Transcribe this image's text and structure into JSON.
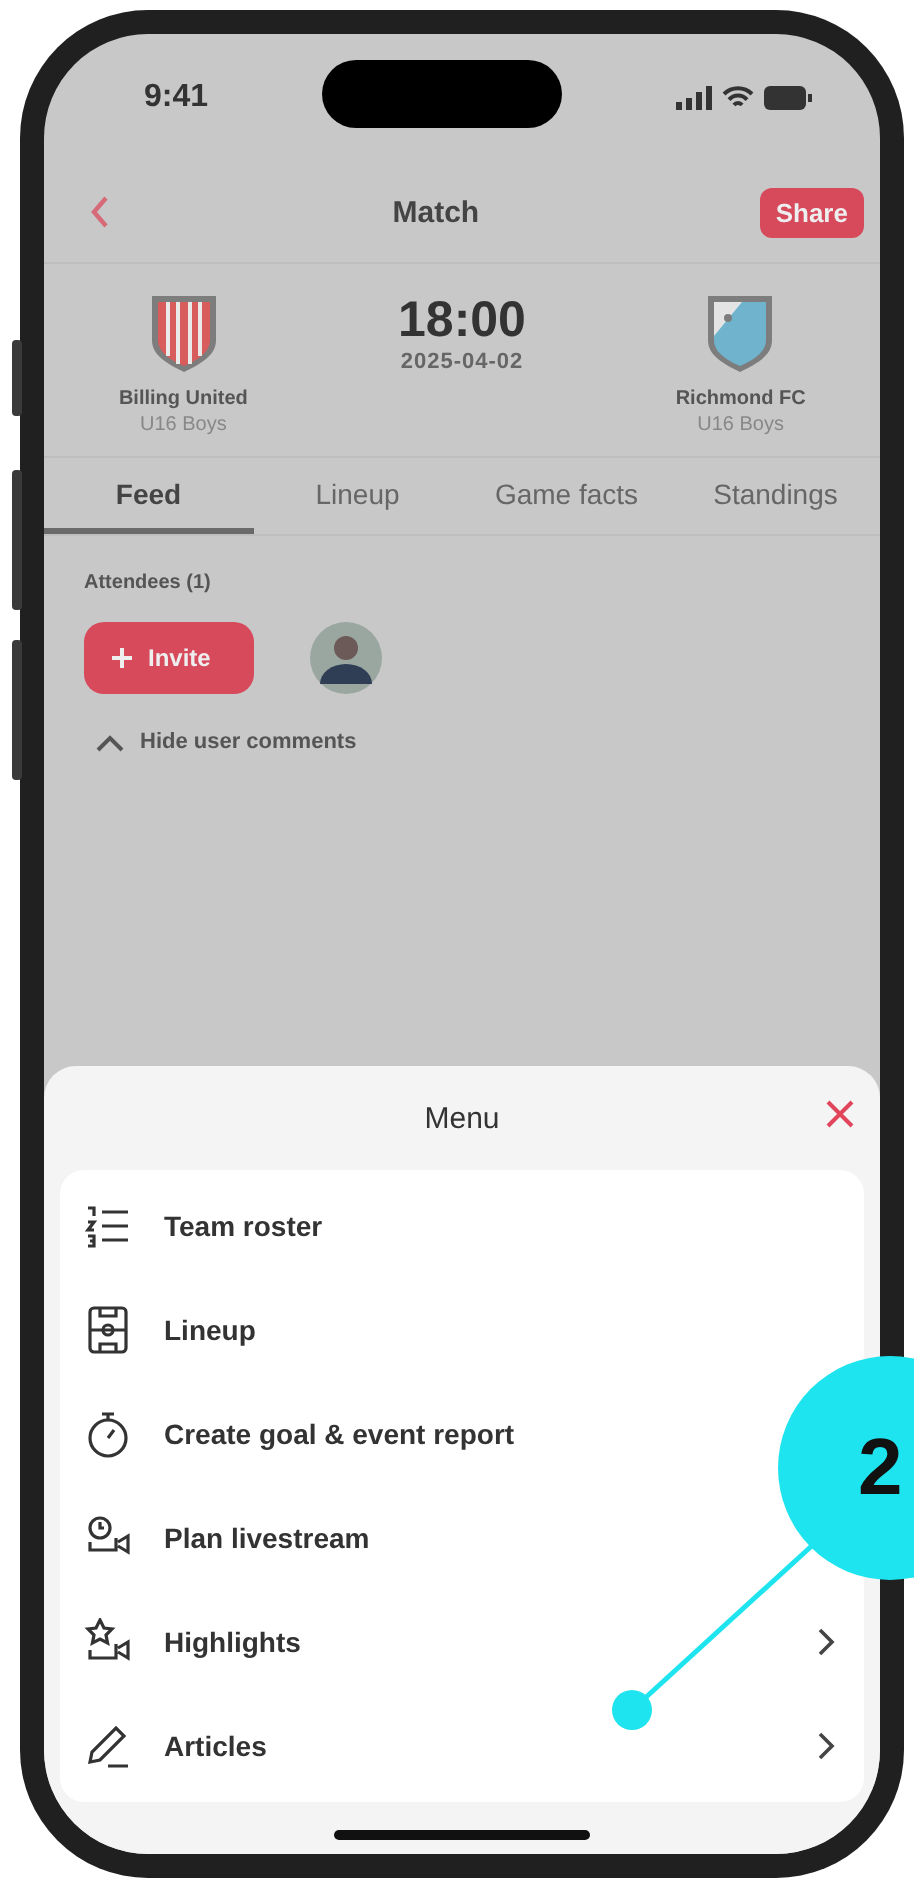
{
  "status_bar": {
    "time": "9:41"
  },
  "header": {
    "title": "Match",
    "share_button": "Share"
  },
  "match": {
    "time": "18:00",
    "date": "2025-04-02",
    "teams": [
      {
        "name": "Billing United",
        "group": "U16 Boys",
        "kind": "stripes"
      },
      {
        "name": "Richmond FC",
        "group": "U16 Boys",
        "kind": "wave"
      }
    ]
  },
  "tabs": [
    {
      "label": "Feed",
      "selected": true
    },
    {
      "label": "Lineup",
      "selected": false
    },
    {
      "label": "Game facts",
      "selected": false
    },
    {
      "label": "Standings",
      "selected": false
    }
  ],
  "attendees": {
    "heading": "Attendees (1)",
    "invite_button": "Invite"
  },
  "comments_toggle": "Hide user comments",
  "menu": {
    "title": "Menu",
    "items": [
      {
        "label": "Team roster",
        "kind": "roster",
        "arrow": false
      },
      {
        "label": "Lineup",
        "kind": "lineup",
        "arrow": false
      },
      {
        "label": "Create goal & event report",
        "kind": "stopwatch",
        "arrow": false
      },
      {
        "label": "Plan livestream",
        "kind": "livestream",
        "arrow": false
      },
      {
        "label": "Highlights",
        "kind": "highlights",
        "arrow": true
      },
      {
        "label": "Articles",
        "kind": "pen",
        "arrow": true
      }
    ]
  },
  "callout": {
    "number": "2"
  }
}
